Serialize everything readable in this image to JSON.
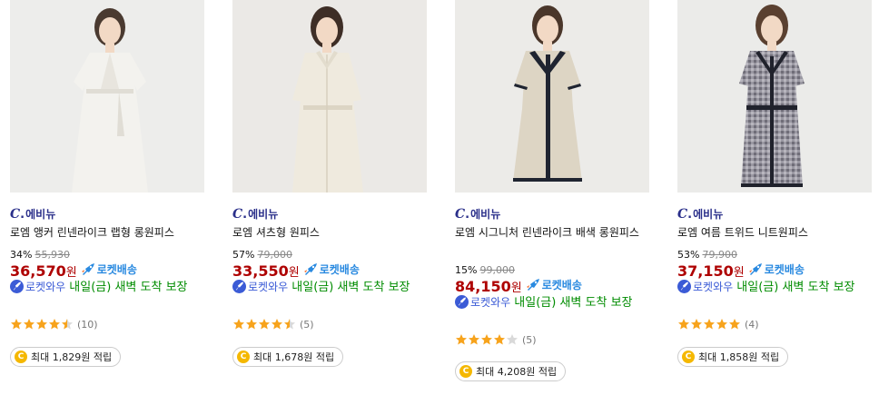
{
  "products": [
    {
      "brand": {
        "mark": "C",
        "dot": ".",
        "name": "에비뉴"
      },
      "title": "로엠 앵커 린넨라이크 랩형 롱원피스",
      "discount": "34%",
      "original_price": "55,930",
      "price": "36,570",
      "won": "원",
      "rocket": "로켓배송",
      "wow_label": "로켓와우",
      "delivery": " 내일(금) 새벽 도착 보장",
      "rating": 4.5,
      "review_count": "(10)",
      "points": "최대 1,829원 적립",
      "dress_color": "#f1f0ec",
      "accent_color": "#e6e3dc"
    },
    {
      "brand": {
        "mark": "C",
        "dot": ".",
        "name": "에비뉴"
      },
      "title": "로엠 셔츠형 원피스",
      "discount": "57%",
      "original_price": "79,000",
      "price": "33,550",
      "won": "원",
      "rocket": "로켓배송",
      "wow_label": "로켓와우",
      "delivery": " 내일(금) 새벽 도착 보장",
      "rating": 4.5,
      "review_count": "(5)",
      "points": "최대 1,678원 적립",
      "dress_color": "#efeade",
      "accent_color": "#e2dccd"
    },
    {
      "brand": {
        "mark": "C",
        "dot": ".",
        "name": "에비뉴"
      },
      "title": "로엠 시그니처 린넨라이크 배색 롱원피스",
      "discount": "15%",
      "original_price": "99,000",
      "price": "84,150",
      "won": "원",
      "rocket": "로켓배송",
      "wow_label": "로켓와우",
      "delivery": " 내일(금) 새벽 도착 보장",
      "rating": 4,
      "review_count": "(5)",
      "points": "최대 4,208원 적립",
      "dress_color": "#ddd5c4",
      "accent_color": "#1f2430"
    },
    {
      "brand": {
        "mark": "C",
        "dot": ".",
        "name": "에비뉴"
      },
      "title": "로엠 여름 트위드 니트원피스",
      "discount": "53%",
      "original_price": "79,900",
      "price": "37,150",
      "won": "원",
      "rocket": "로켓배송",
      "wow_label": "로켓와우",
      "delivery": " 내일(금) 새벽 도착 보장",
      "rating": 5,
      "review_count": "(4)",
      "points": "최대 1,858원 적립",
      "dress_color": "#8c8a93",
      "accent_color": "#20222c"
    }
  ],
  "colors": {
    "price": "#ae0000",
    "rocket": "#2a8ae0",
    "delivery": "#008c00",
    "brand": "#2a2f8a",
    "star": "#f7a31c"
  },
  "icons": [
    "rocket-icon",
    "wow-rocket-icon",
    "star-icon",
    "coin-icon"
  ]
}
